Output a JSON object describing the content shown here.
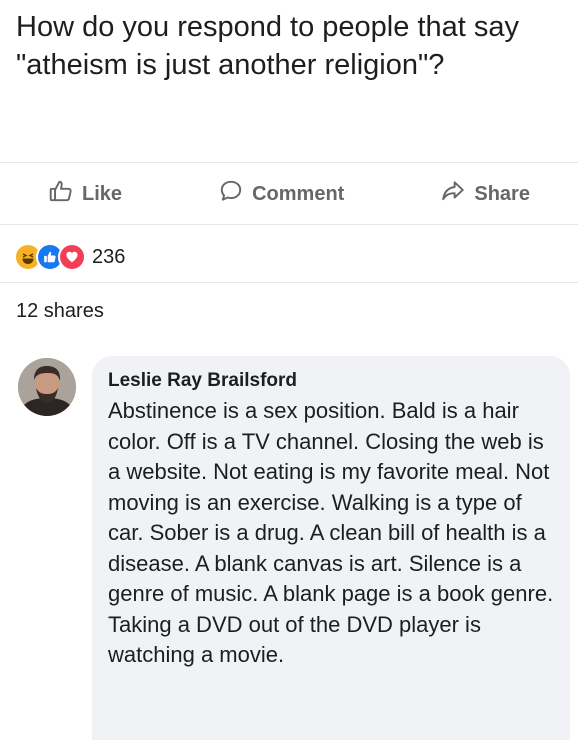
{
  "post": {
    "text": "How do you respond to people that say \"atheism is just another religion\"?"
  },
  "actions": {
    "like_label": "Like",
    "comment_label": "Comment",
    "share_label": "Share"
  },
  "reactions": {
    "icons": [
      "haha-icon",
      "like-icon",
      "love-icon"
    ],
    "count": "236"
  },
  "shares": "12 shares",
  "comment": {
    "author": "Leslie Ray Brailsford",
    "text": "Abstinence is a sex position.  Bald is a hair color.  Off is a TV channel. Closing the web is a website.  Not eating is my favorite meal.  Not moving is an exercise.  Walking is a type of car.  Sober is a drug.  A clean bill of health is a disease.  A blank canvas is art.  Silence is a genre of music.  A blank page is a book genre.  Taking a DVD out of the DVD player is watching a movie."
  },
  "colors": {
    "text": "#1c1e21",
    "muted": "#65676b",
    "bubble": "#f0f2f5",
    "divider": "#e4e6eb",
    "haha": "#f7b125",
    "like": "#1877f2",
    "love": "#f33e58"
  }
}
